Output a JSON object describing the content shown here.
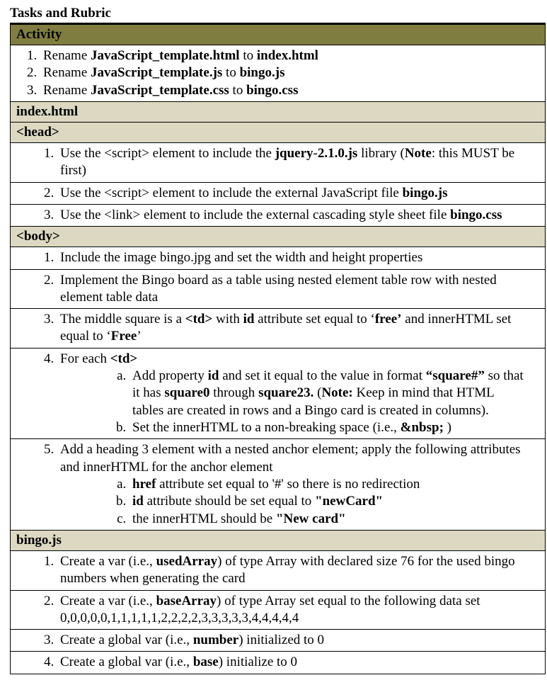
{
  "title": "Tasks and Rubric",
  "sections": {
    "activity": "Activity",
    "index_html": "index.html",
    "head_tag": "<head>",
    "body_tag": "<body>",
    "bingo_js": "bingo.js"
  },
  "activity_items": [
    {
      "pre": "Rename ",
      "b1": "JavaScript_template.html",
      "mid": " to ",
      "b2": "index.html"
    },
    {
      "pre": "Rename ",
      "b1": "JavaScript_template.js",
      "mid": " to ",
      "b2": "bingo.js"
    },
    {
      "pre": "Rename ",
      "b1": "JavaScript_template.css",
      "mid": " to ",
      "b2": "bingo.css"
    }
  ],
  "head_items": {
    "r1": {
      "p1": "Use the <script> element to include the ",
      "b1": "jquery",
      "p2": "-",
      "b2": "2.1.0.js",
      "p3": " library (",
      "b3": "Note",
      "p4": ": this MUST be first)"
    },
    "r2": {
      "p1": "Use the <script> element to include the external JavaScript file ",
      "b1": "bingo.js"
    },
    "r3": {
      "p1": "Use the <link> element to include the external cascading style sheet file ",
      "b1": "bingo.css"
    }
  },
  "body_items": {
    "r1": "Include the image bingo.jpg and set the width and height properties",
    "r2": "Implement the Bingo board as a table using nested element table row with nested element table data",
    "r3": {
      "p1": "The middle square is a ",
      "b1": "<td>",
      "p2": " with ",
      "b2": "id",
      "p3": " attribute set equal to ‘",
      "b3": "free’",
      "p4": " and innerHTML set equal to ‘",
      "b4": "Free",
      "p5": "’"
    },
    "r4": {
      "p1": "For each ",
      "b1": "<td>"
    },
    "r4a": {
      "p1": "Add property ",
      "b1": "id",
      "p2": " and set it equal to the value in format ",
      "b2": "“square#”",
      "p3": " so that it has ",
      "b3": "square0",
      "p4": " through ",
      "b4": "square23.",
      "p5": "  (",
      "b5": "Note:",
      "p6": " Keep in mind that HTML tables are created in rows and a Bingo card is created in columns)."
    },
    "r4b": {
      "p1": "Set the innerHTML to a non-breaking space (i.e., ",
      "b1": "&nbsp;",
      "p2": " )"
    },
    "r5": "Add a heading 3 element with a nested anchor element; apply the following attributes and innerHTML for the anchor element",
    "r5a": {
      "b1": "href",
      "p1": " attribute set equal to '#' so there is no redirection"
    },
    "r5b": {
      "b1": "id",
      "p1": " attribute should be set equal to ",
      "b2": "\"newCard\""
    },
    "r5c": {
      "p1": "the innerHTML should be ",
      "b1": "\"New card\""
    }
  },
  "bingo_items": {
    "r1": {
      "p1": "Create a var (i.e., ",
      "b1": "usedArray",
      "p2": ") of type Array with declared size 76 for the used bingo numbers when generating the card"
    },
    "r2": {
      "p1": "Create a var (i.e., ",
      "b1": "baseArray",
      "p2": ") of type Array set equal to the following data set 0,0,0,0,0,1,1,1,1,1,2,2,2,2,3,3,3,3,3,4,4,4,4,4"
    },
    "r3": {
      "p1": "Create a global var (i.e., ",
      "b1": "number",
      "p2": ") initialized to 0"
    },
    "r4": {
      "p1": "Create a global var (i.e., ",
      "b1": "base",
      "p2": ") initialize to 0"
    }
  }
}
